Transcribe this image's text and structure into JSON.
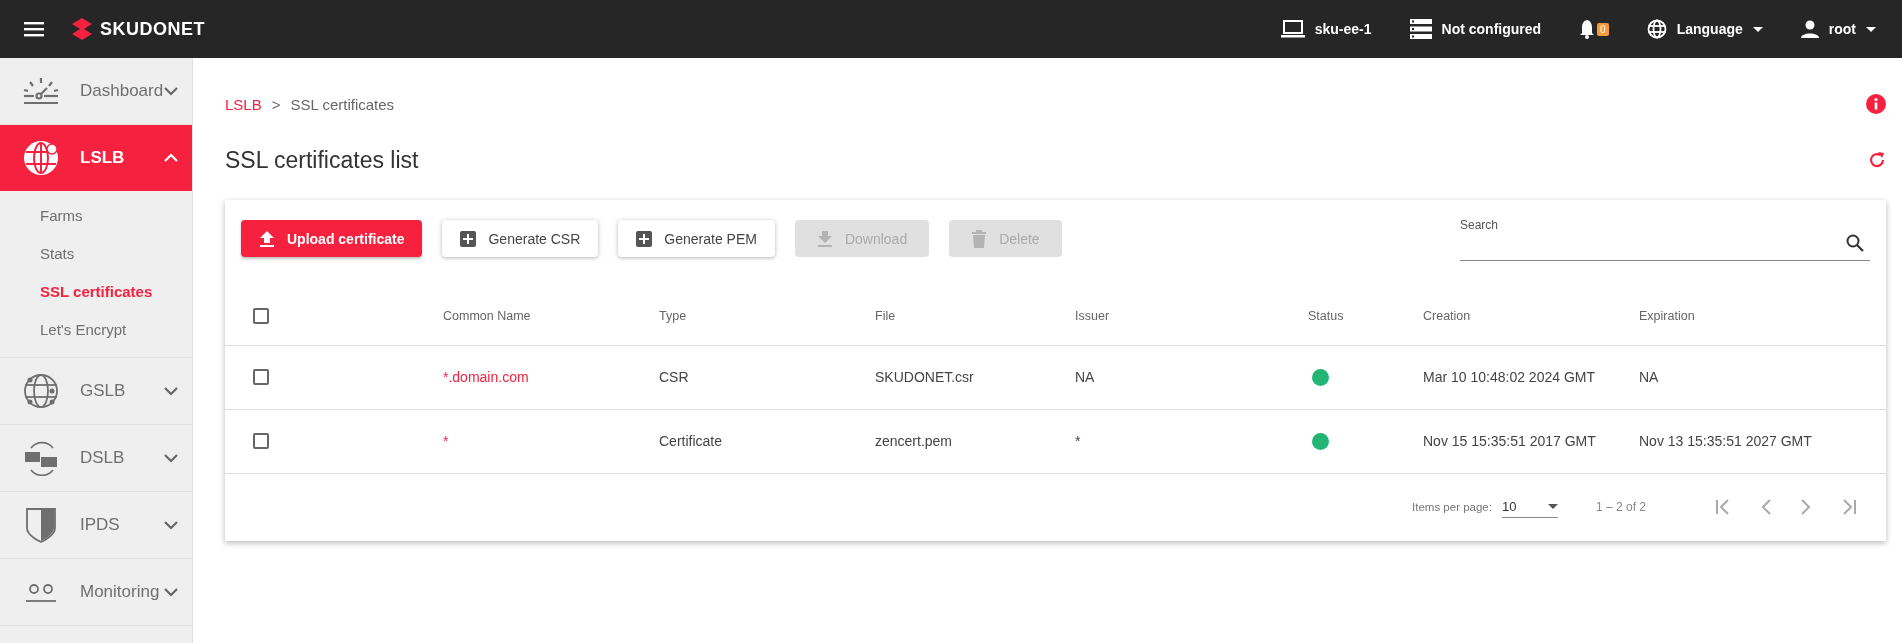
{
  "topbar": {
    "brand": "SKUDONET",
    "host": "sku-ee-1",
    "cluster": "Not configured",
    "notifications": "0",
    "language": "Language",
    "user": "root"
  },
  "sidebar": {
    "items": [
      {
        "label": "Dashboard",
        "selected": false,
        "expanded": false
      },
      {
        "label": "LSLB",
        "selected": true,
        "expanded": true,
        "children": [
          {
            "label": "Farms",
            "selected": false
          },
          {
            "label": "Stats",
            "selected": false
          },
          {
            "label": "SSL certificates",
            "selected": true
          },
          {
            "label": "Let's Encrypt",
            "selected": false
          }
        ]
      },
      {
        "label": "GSLB",
        "selected": false,
        "expanded": false
      },
      {
        "label": "DSLB",
        "selected": false,
        "expanded": false
      },
      {
        "label": "IPDS",
        "selected": false,
        "expanded": false
      },
      {
        "label": "Monitoring",
        "selected": false,
        "expanded": false
      }
    ]
  },
  "breadcrumb": [
    "LSLB",
    ">",
    "SSL certificates"
  ],
  "page_title": "SSL certificates list",
  "toolbar": {
    "buttons": [
      {
        "label": "Upload certificate",
        "kind": "primary",
        "disabled": false
      },
      {
        "label": "Generate CSR",
        "kind": "plain",
        "disabled": false
      },
      {
        "label": "Generate PEM",
        "kind": "plain",
        "disabled": false
      },
      {
        "label": "Download",
        "kind": "plain",
        "disabled": true
      },
      {
        "label": "Delete",
        "kind": "plain",
        "disabled": true
      }
    ],
    "search": {
      "label": "Search"
    }
  },
  "table": {
    "select_all": {
      "checked": false
    },
    "columns": [
      "Common Name",
      "Type",
      "File",
      "Issuer",
      "Status",
      "Creation",
      "Expiration"
    ],
    "rows": [
      {
        "checked": false,
        "common_name": "*.domain.com",
        "type": "CSR",
        "file": "SKUDONET.csr",
        "issuer": "NA",
        "color": "#22b573",
        "creation": "Mar 10 10:48:02 2024 GMT",
        "expiration": "NA"
      },
      {
        "checked": false,
        "common_name": "*",
        "type": "Certificate",
        "file": "zencert.pem",
        "issuer": "*",
        "color": "#22b573",
        "creation": "Nov 15 15:35:51 2017 GMT",
        "expiration": "Nov 13 15:35:51 2027 GMT"
      }
    ]
  },
  "paginator": {
    "label": "Items per page:",
    "page_size": "10",
    "range": "1 – 2 of 2"
  }
}
